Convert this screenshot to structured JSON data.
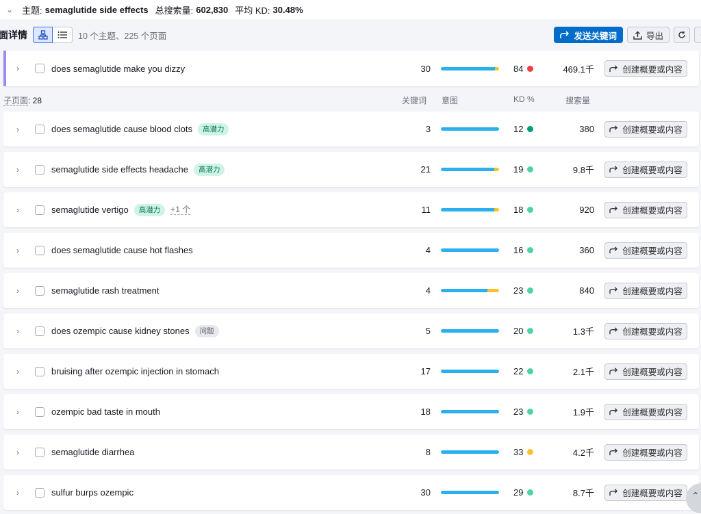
{
  "topic_bar": {
    "prefix": "主题:",
    "topic": "semaglutide side effects",
    "volume_label": "总搜索量:",
    "volume": "602,830",
    "kd_label": "平均 KD:",
    "kd": "30.48%"
  },
  "toolbar": {
    "title": "面详情",
    "counts": "10 个主题、225 个页面",
    "send_label": "发送关键词",
    "export_label": "导出"
  },
  "parent_row": {
    "keyword": "does semaglutide make you dizzy",
    "count": "30",
    "intent": {
      "blue": 0.93,
      "yellow": 0.07
    },
    "kd": "84",
    "kd_color": "#f23a4b",
    "volume": "469.1千",
    "action": "创建概要或内容"
  },
  "subheader": {
    "subpages_label": "子页面",
    "subpages_count": ": 28",
    "col_keywords": "关键词",
    "col_intent": "意图",
    "col_kd": "KD %",
    "col_volume": "搜索量"
  },
  "rows": [
    {
      "keyword": "does semaglutide cause blood clots",
      "tag": "高潜力",
      "tag_style": "green",
      "more": "",
      "count": "3",
      "intent": {
        "blue": 1.0,
        "yellow": 0
      },
      "kd": "12",
      "kd_color": "#009f75",
      "volume": "380",
      "action": "创建概要或内容"
    },
    {
      "keyword": "semaglutide side effects headache",
      "tag": "高潜力",
      "tag_style": "green",
      "more": "",
      "count": "21",
      "intent": {
        "blue": 0.92,
        "yellow": 0.08
      },
      "kd": "19",
      "kd_color": "#4ed4a0",
      "volume": "9.8千",
      "action": "创建概要或内容"
    },
    {
      "keyword": "semaglutide vertigo",
      "tag": "高潜力",
      "tag_style": "green",
      "more": "+1 个",
      "count": "11",
      "intent": {
        "blue": 0.92,
        "yellow": 0.08
      },
      "kd": "18",
      "kd_color": "#4ed4a0",
      "volume": "920",
      "action": "创建概要或内容"
    },
    {
      "keyword": "does semaglutide cause hot flashes",
      "tag": "",
      "tag_style": "",
      "more": "",
      "count": "4",
      "intent": {
        "blue": 1.0,
        "yellow": 0
      },
      "kd": "16",
      "kd_color": "#4ed4a0",
      "volume": "360",
      "action": "创建概要或内容"
    },
    {
      "keyword": "semaglutide rash treatment",
      "tag": "",
      "tag_style": "",
      "more": "",
      "count": "4",
      "intent": {
        "blue": 0.8,
        "yellow": 0.2
      },
      "kd": "23",
      "kd_color": "#4ed4a0",
      "volume": "840",
      "action": "创建概要或内容"
    },
    {
      "keyword": "does ozempic cause kidney stones",
      "tag": "问题",
      "tag_style": "gray",
      "more": "",
      "count": "5",
      "intent": {
        "blue": 1.0,
        "yellow": 0
      },
      "kd": "20",
      "kd_color": "#4ed4a0",
      "volume": "1.3千",
      "action": "创建概要或内容"
    },
    {
      "keyword": "bruising after ozempic injection in stomach",
      "tag": "",
      "tag_style": "",
      "more": "",
      "count": "17",
      "intent": {
        "blue": 1.0,
        "yellow": 0
      },
      "kd": "22",
      "kd_color": "#4ed4a0",
      "volume": "2.1千",
      "action": "创建概要或内容"
    },
    {
      "keyword": "ozempic bad taste in mouth",
      "tag": "",
      "tag_style": "",
      "more": "",
      "count": "18",
      "intent": {
        "blue": 1.0,
        "yellow": 0
      },
      "kd": "23",
      "kd_color": "#4ed4a0",
      "volume": "1.9千",
      "action": "创建概要或内容"
    },
    {
      "keyword": "semaglutide diarrhea",
      "tag": "",
      "tag_style": "",
      "more": "",
      "count": "8",
      "intent": {
        "blue": 1.0,
        "yellow": 0
      },
      "kd": "33",
      "kd_color": "#fbc02d",
      "volume": "4.2千",
      "action": "创建概要或内容"
    },
    {
      "keyword": "sulfur burps ozempic",
      "tag": "",
      "tag_style": "",
      "more": "",
      "count": "30",
      "intent": {
        "blue": 1.0,
        "yellow": 0
      },
      "kd": "29",
      "kd_color": "#4ed4a0",
      "volume": "8.7千",
      "action": "创建概要或内容"
    }
  ]
}
